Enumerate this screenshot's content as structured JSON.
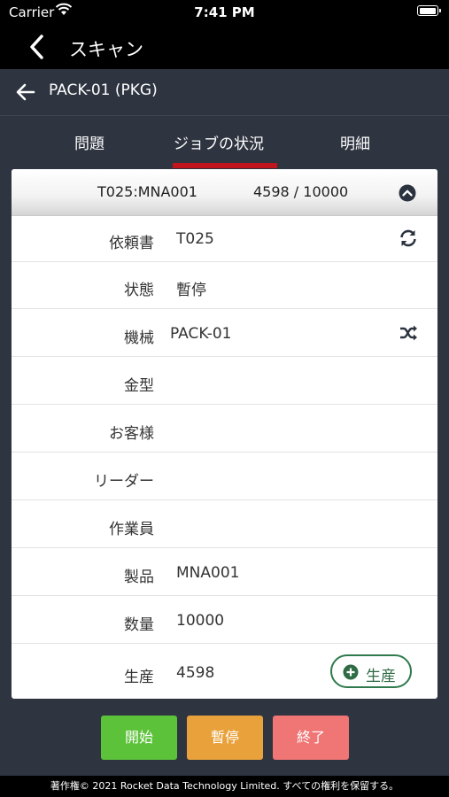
{
  "status_bar": {
    "carrier": "Carrier",
    "time": "7:41 PM"
  },
  "nav": {
    "title": "スキャン"
  },
  "sub_header": {
    "title": "PACK-01 (PKG)"
  },
  "tabs": [
    {
      "label": "問題",
      "active": false
    },
    {
      "label": "ジョブの状況",
      "active": true
    },
    {
      "label": "明細",
      "active": false
    }
  ],
  "job_header": {
    "job": "T025:MNA001",
    "progress": "4598 / 10000"
  },
  "fields": {
    "order": {
      "label": "依頼書",
      "value": "T025"
    },
    "status": {
      "label": "状態",
      "value": "暫停"
    },
    "machine": {
      "label": "機械",
      "value": "PACK-01"
    },
    "mold": {
      "label": "金型",
      "value": ""
    },
    "customer": {
      "label": "お客様",
      "value": ""
    },
    "leader": {
      "label": "リーダー",
      "value": ""
    },
    "worker": {
      "label": "作業員",
      "value": ""
    },
    "product": {
      "label": "製品",
      "value": "MNA001"
    },
    "quantity": {
      "label": "数量",
      "value": "10000"
    },
    "produced": {
      "label": "生産",
      "value": "4598"
    }
  },
  "produce_button": {
    "label": "生産"
  },
  "actions": {
    "start": {
      "label": "開始",
      "color": "#5cc23a"
    },
    "pause": {
      "label": "暫停",
      "color": "#e9a23b"
    },
    "end": {
      "label": "終了",
      "color": "#f07575"
    }
  },
  "footer": {
    "copyright": "著作権© 2021 Rocket Data Technology Limited. すべての権利を保留する。"
  },
  "colors": {
    "accent_red": "#c0151c",
    "green": "#2f7a4c",
    "bg": "#2e3440"
  },
  "icons": [
    "wifi-icon",
    "battery-icon",
    "chevron-left-icon",
    "arrow-left-icon",
    "chevron-up-circle-icon",
    "refresh-icon",
    "shuffle-icon",
    "plus-circle-icon"
  ]
}
